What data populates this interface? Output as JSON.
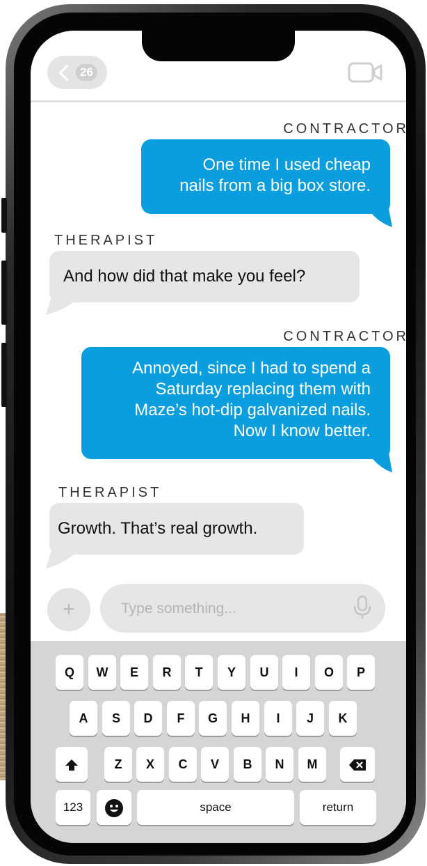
{
  "header": {
    "unread_count": "26"
  },
  "messages": [
    {
      "sender": "CONTRACTOR",
      "lines": [
        "One time I used cheap",
        "nails from a big box store."
      ]
    },
    {
      "sender": "THERAPIST",
      "lines": [
        "And how did that make you feel?"
      ]
    },
    {
      "sender": "CONTRACTOR",
      "lines": [
        "Annoyed, since I had to spend a",
        "Saturday replacing them with",
        "Maze’s hot-dip galvanized nails.",
        "Now I know better."
      ]
    },
    {
      "sender": "THERAPIST",
      "lines": [
        "Growth. That’s real growth."
      ]
    }
  ],
  "composer": {
    "plus_label": "+",
    "placeholder": "Type something..."
  },
  "keyboard": {
    "row1": [
      "Q",
      "W",
      "E",
      "R",
      "T",
      "Y",
      "U",
      "I",
      "O",
      "P"
    ],
    "row2": [
      "A",
      "S",
      "D",
      "F",
      "G",
      "H",
      "I",
      "J",
      "K"
    ],
    "row3": [
      "Z",
      "X",
      "C",
      "V",
      "B",
      "N",
      "M"
    ],
    "numbers_label": "123",
    "space_label": "space",
    "return_label": "return"
  },
  "colors": {
    "outgoing": "#0a9ede",
    "incoming": "#e6e6e6"
  },
  "icons": [
    "back-chevron-icon",
    "video-camera-icon",
    "microphone-icon",
    "shift-arrow-icon",
    "delete-icon",
    "emoji-icon"
  ]
}
